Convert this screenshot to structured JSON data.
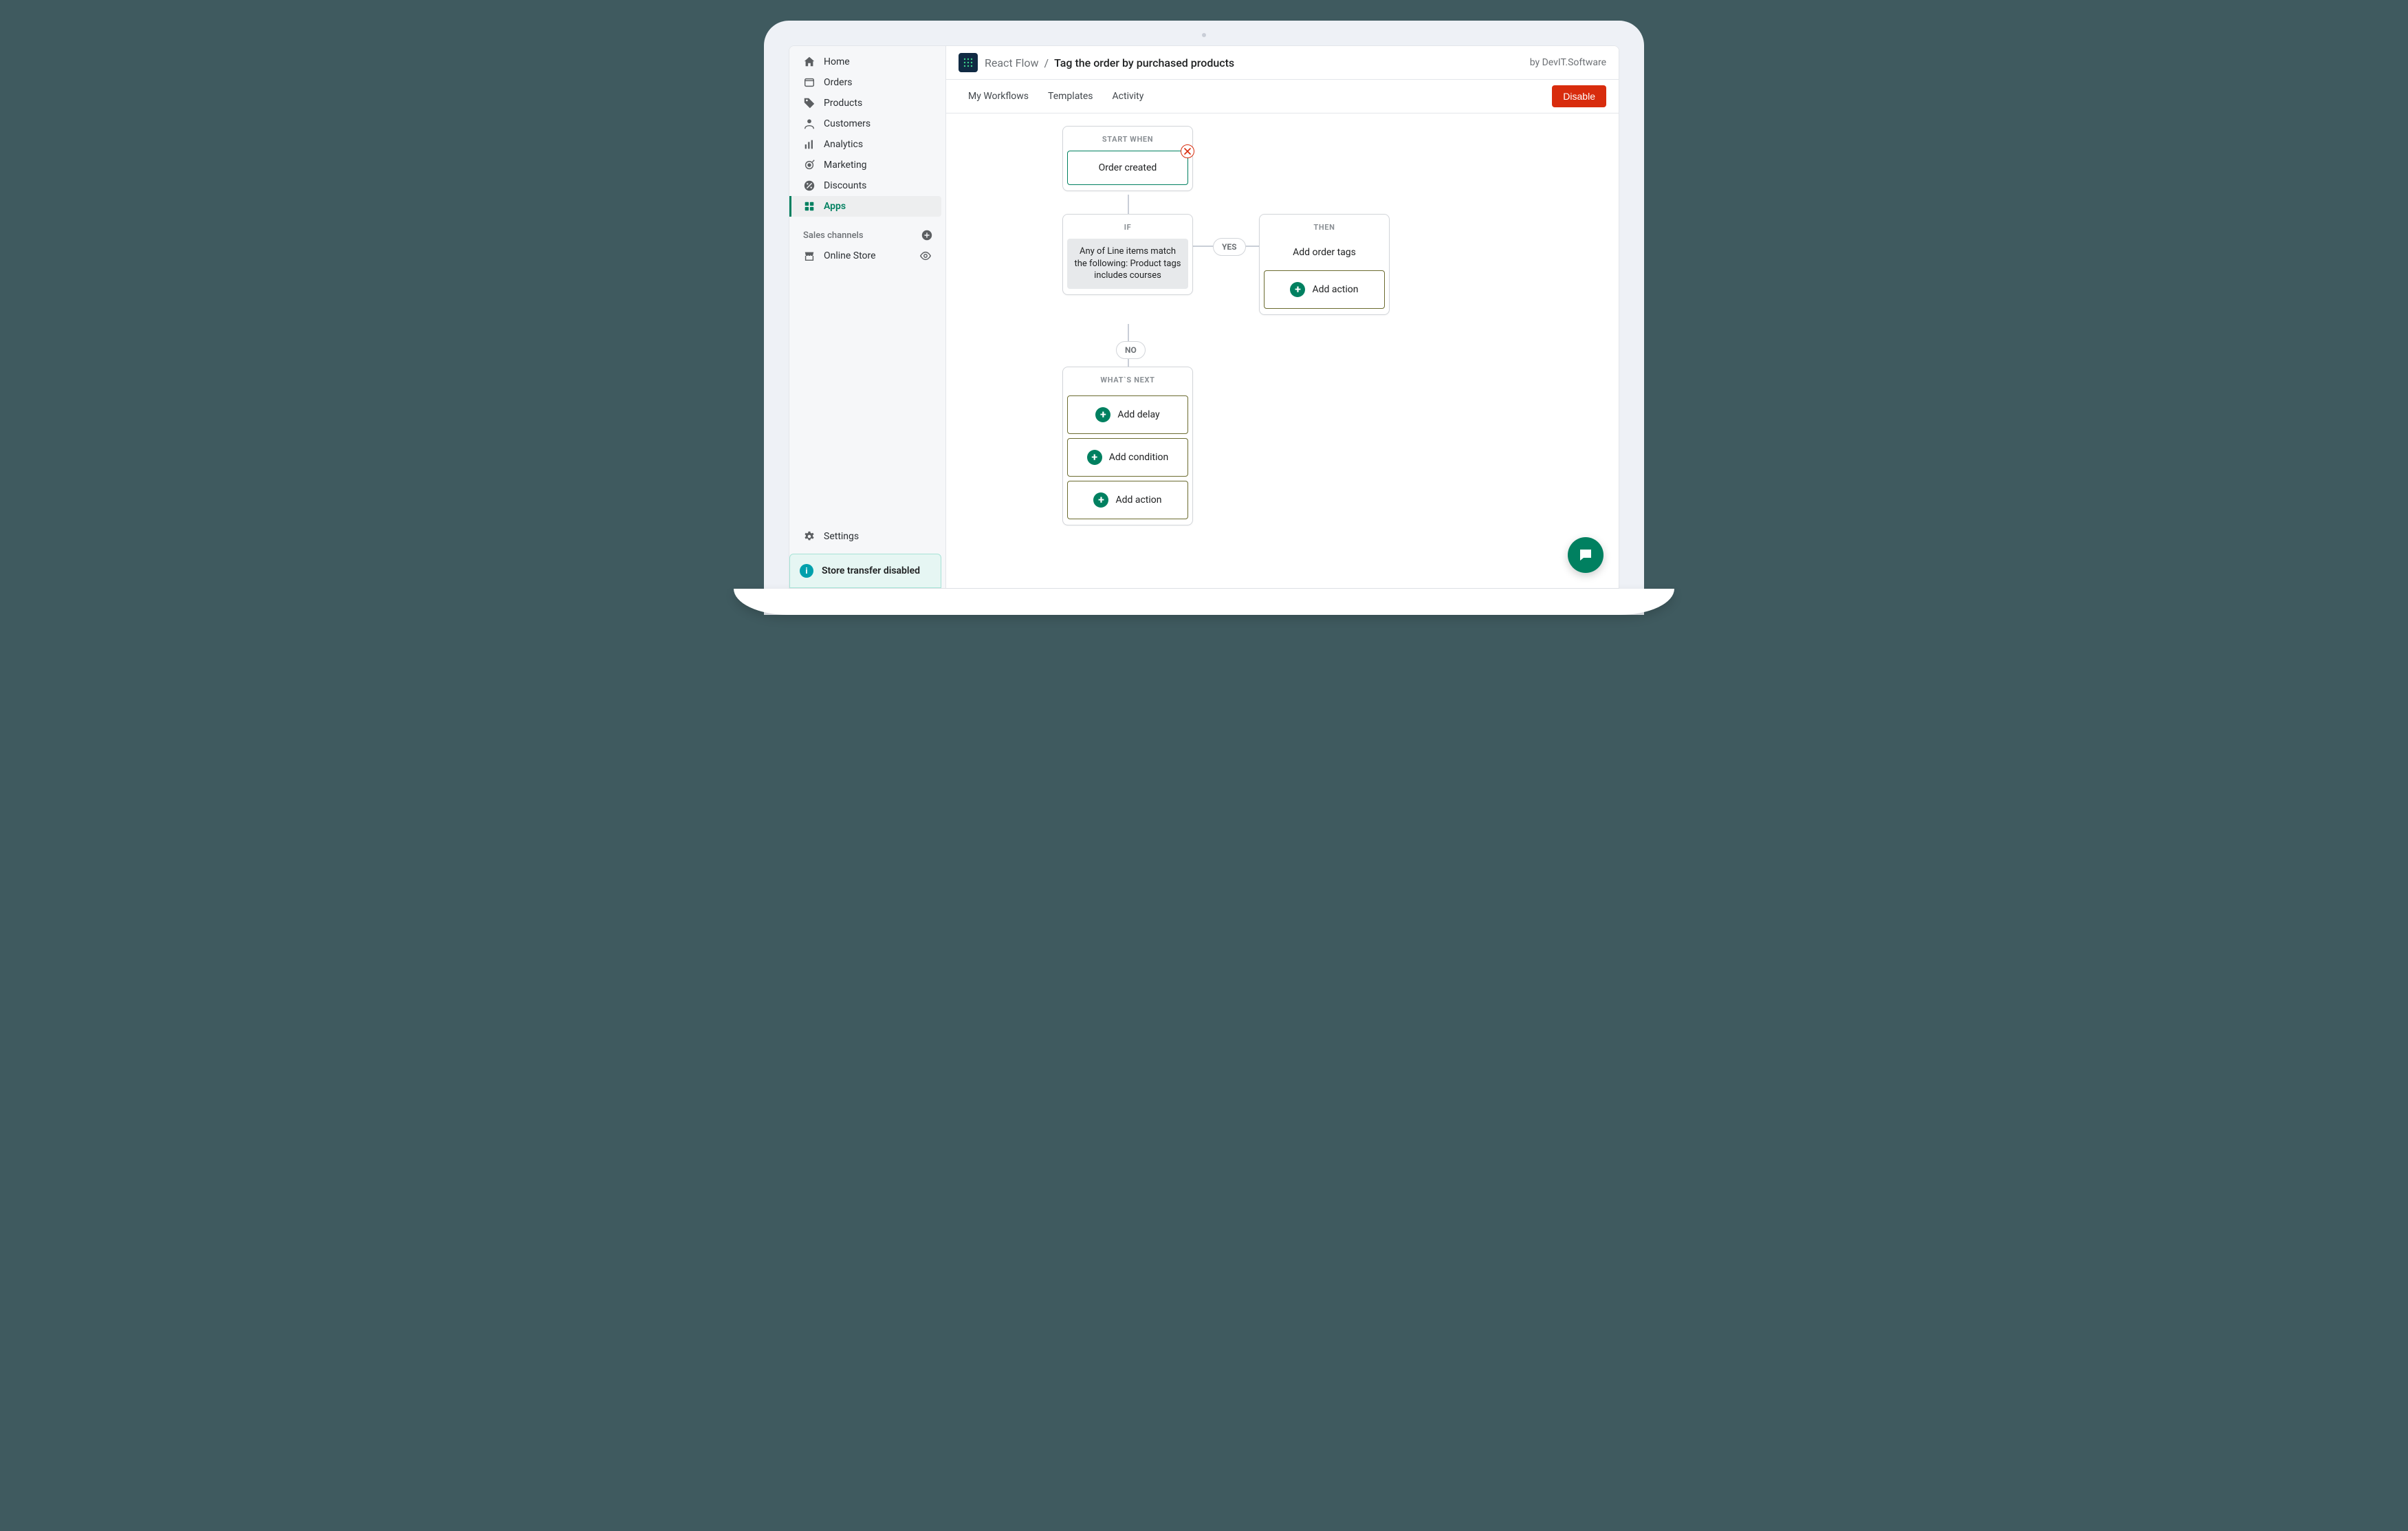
{
  "sidebar": {
    "items": [
      {
        "label": "Home"
      },
      {
        "label": "Orders"
      },
      {
        "label": "Products"
      },
      {
        "label": "Customers"
      },
      {
        "label": "Analytics"
      },
      {
        "label": "Marketing"
      },
      {
        "label": "Discounts"
      },
      {
        "label": "Apps"
      }
    ],
    "section_label": "Sales channels",
    "channel_label": "Online Store",
    "settings_label": "Settings",
    "banner_text": "Store transfer disabled"
  },
  "topbar": {
    "app_name": "React Flow",
    "separator": "/",
    "title": "Tag the order by purchased products",
    "byline": "by DevIT.Software"
  },
  "tabs": {
    "items": [
      {
        "label": "My Workflows"
      },
      {
        "label": "Templates"
      },
      {
        "label": "Activity"
      }
    ],
    "disable_label": "Disable"
  },
  "flow": {
    "start": {
      "header": "START WHEN",
      "trigger": "Order created"
    },
    "if": {
      "header": "IF",
      "condition": "Any of Line items match the following: Product tags includes courses"
    },
    "yes_label": "YES",
    "no_label": "NO",
    "then": {
      "header": "THEN",
      "action_text": "Add order tags",
      "add_action_label": "Add action"
    },
    "next": {
      "header": "WHAT`S NEXT",
      "buttons": [
        {
          "label": "Add delay"
        },
        {
          "label": "Add condition"
        },
        {
          "label": "Add action"
        }
      ]
    }
  },
  "colors": {
    "accent": "#008060",
    "danger": "#d82c0d"
  }
}
